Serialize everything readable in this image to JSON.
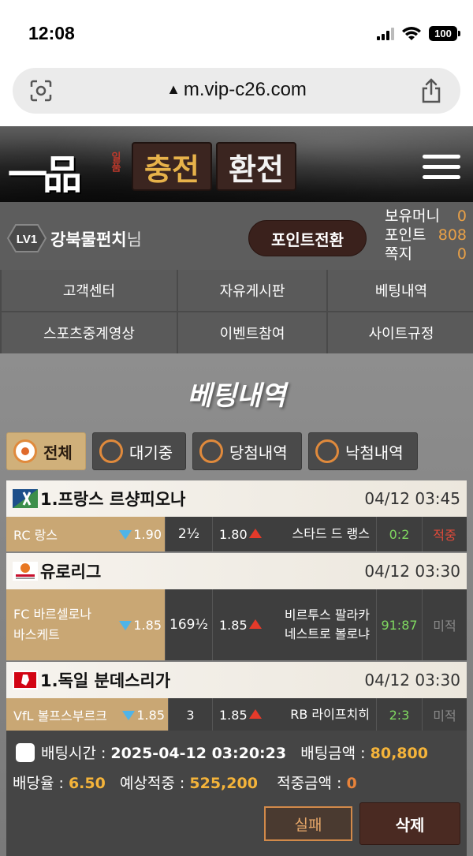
{
  "status": {
    "time": "12:08",
    "battery": "100"
  },
  "browser": {
    "url": "m.vip-c26.com"
  },
  "header": {
    "logo": "一品",
    "logo_sub": "일품",
    "charge_label": "충전",
    "exchange_label": "환전"
  },
  "user": {
    "level": "LV1",
    "name": "강북물펀치",
    "suffix": "님",
    "point_button": "포인트전환",
    "balances": [
      {
        "label": "보유머니",
        "value": "0"
      },
      {
        "label": "포인트",
        "value": "808"
      },
      {
        "label": "쪽지",
        "value": "0"
      }
    ]
  },
  "nav": [
    "고객센터",
    "자유게시판",
    "베팅내역",
    "스포츠중계영상",
    "이벤트참여",
    "사이트규정"
  ],
  "page_title": "베팅내역",
  "filters": [
    {
      "label": "전체",
      "active": true
    },
    {
      "label": "대기중",
      "active": false
    },
    {
      "label": "당첨내역",
      "active": false
    },
    {
      "label": "낙첨내역",
      "active": false
    }
  ],
  "bets": [
    {
      "league": "1.프랑스 르샹피오나",
      "date": "04/12 03:45",
      "home": "RC 랑스",
      "home_odd": "1.90",
      "line": "2½",
      "away_odd": "1.80",
      "away": "스타드 드 랭스",
      "score": "0:2",
      "result": "적중"
    },
    {
      "league": "유로리그",
      "date": "04/12 03:30",
      "home": "FC 바르셀로나 바스케트",
      "home_odd": "1.85",
      "line": "169½",
      "away_odd": "1.85",
      "away": "비르투스 팔라카네스트로 볼로냐",
      "score": "91:87",
      "result": "미적"
    },
    {
      "league": "1.독일 분데스리가",
      "date": "04/12 03:30",
      "home": "VfL 볼프스부르크",
      "home_odd": "1.85",
      "line": "3",
      "away_odd": "1.85",
      "away": "RB 라이프치히",
      "score": "2:3",
      "result": "미적"
    }
  ],
  "summary": {
    "bet_time_label": "배팅시간 :",
    "bet_time": "2025-04-12 03:20:23",
    "bet_amount_label": "배팅금액 :",
    "bet_amount": "80,800",
    "odds_label": "배당율 :",
    "odds": "6.50",
    "expected_label": "예상적중 :",
    "expected": "525,200",
    "won_label": "적중금액 :",
    "won": "0",
    "fail_label": "실패",
    "delete_label": "삭제"
  },
  "colors": {
    "accent_gold": "#d0b07a",
    "win_red": "#e14b3a",
    "score_green": "#7fd860",
    "value_orange": "#e8a047"
  }
}
